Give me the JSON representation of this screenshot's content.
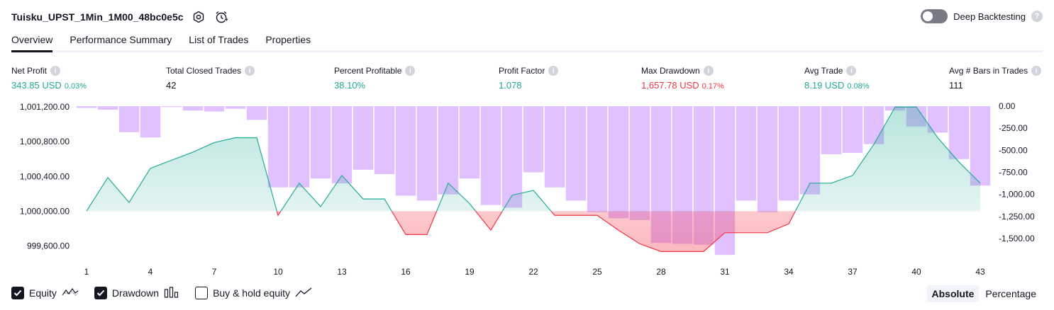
{
  "header": {
    "strategy_name": "Tuisku_UPST_1Min_1M00_48bc0e5c",
    "settings_icon": "gear-icon",
    "alert_icon": "alarm-clock-icon",
    "deep_backtesting_label": "Deep Backtesting",
    "deep_backtesting_enabled": false
  },
  "tabs": [
    {
      "label": "Overview",
      "active": true
    },
    {
      "label": "Performance Summary",
      "active": false
    },
    {
      "label": "List of Trades",
      "active": false
    },
    {
      "label": "Properties",
      "active": false
    }
  ],
  "metrics": [
    {
      "label": "Net Profit",
      "value": "343.85 USD",
      "pct": "0.03%",
      "color": "#22ab94"
    },
    {
      "label": "Total Closed Trades",
      "value": "42",
      "pct": "",
      "color": "#131722"
    },
    {
      "label": "Percent Profitable",
      "value": "38.10%",
      "pct": "",
      "color": "#22ab94"
    },
    {
      "label": "Profit Factor",
      "value": "1.078",
      "pct": "",
      "color": "#22ab94"
    },
    {
      "label": "Max Drawdown",
      "value": "1,657.78 USD",
      "pct": "0.17%",
      "color": "#f23645"
    },
    {
      "label": "Avg Trade",
      "value": "8.19 USD",
      "pct": "0.08%",
      "color": "#22ab94"
    },
    {
      "label": "Avg # Bars in Trades",
      "value": "111",
      "pct": "",
      "color": "#131722"
    }
  ],
  "chart_data": {
    "type": "line",
    "baseline": 1000000,
    "x": [
      1,
      2,
      3,
      4,
      5,
      6,
      7,
      8,
      9,
      10,
      11,
      12,
      13,
      14,
      15,
      16,
      17,
      18,
      19,
      20,
      21,
      22,
      23,
      24,
      25,
      26,
      27,
      28,
      29,
      30,
      31,
      32,
      33,
      34,
      35,
      36,
      37,
      38,
      39,
      40,
      41,
      42,
      43
    ],
    "x_tick_labels": [
      "1",
      "4",
      "7",
      "10",
      "13",
      "16",
      "19",
      "22",
      "25",
      "28",
      "31",
      "34",
      "37",
      "40",
      "43"
    ],
    "left_axis": {
      "ticks": [
        "1,001,200.00",
        "1,000,800.00",
        "1,000,400.00",
        "1,000,000.00",
        "999,600.00"
      ],
      "range": [
        999480,
        1001210
      ]
    },
    "right_axis": {
      "ticks": [
        "0.00",
        "-250.00",
        "-500.00",
        "-750.00",
        "-1,000.00",
        "-1,250.00",
        "-1,500.00"
      ],
      "range": [
        -1700,
        0
      ]
    },
    "series": [
      {
        "name": "Equity",
        "axis": "left",
        "colors": {
          "above": "#22ab94",
          "below": "#f23645"
        },
        "values": [
          1000000,
          1000387,
          1000100,
          1000493,
          1000587,
          1000680,
          1000790,
          1000847,
          1000847,
          999951,
          1000322,
          1000052,
          1000411,
          1000140,
          1000140,
          999730,
          999730,
          1000322,
          1000087,
          999780,
          1000183,
          1000239,
          999951,
          999951,
          999951,
          999780,
          999623,
          999534,
          999534,
          999534,
          999751,
          999751,
          999751,
          999853,
          1000322,
          1000322,
          1000411,
          1000770,
          1001200,
          1001200,
          1000847,
          1000566,
          1000322
        ]
      },
      {
        "name": "Drawdown",
        "axis": "right",
        "color": "#e1c0ff",
        "values": [
          -20,
          -40,
          -295,
          -355,
          -10,
          -50,
          -60,
          -30,
          -155,
          -920,
          -920,
          -820,
          -875,
          -720,
          -770,
          -1015,
          -1070,
          -1000,
          -820,
          -1120,
          -1150,
          -750,
          -920,
          -1070,
          -1200,
          -1270,
          -1290,
          -1550,
          -1560,
          -1570,
          -1685,
          -1070,
          -1200,
          -1070,
          -1000,
          -545,
          -530,
          -430,
          -50,
          -230,
          -300,
          -600,
          -900
        ]
      }
    ]
  },
  "legend": [
    {
      "label": "Equity",
      "checked": true,
      "icon": "equity-line-icon"
    },
    {
      "label": "Drawdown",
      "checked": true,
      "icon": "drawdown-bars-icon"
    },
    {
      "label": "Buy & hold equity",
      "checked": false,
      "icon": "buy-hold-line-icon"
    }
  ],
  "modes": [
    {
      "label": "Absolute",
      "active": true
    },
    {
      "label": "Percentage",
      "active": false
    }
  ]
}
